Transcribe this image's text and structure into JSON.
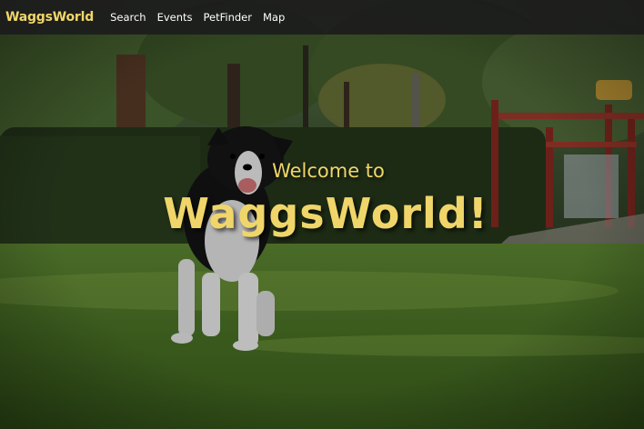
{
  "nav": {
    "brand": "WaggsWorld",
    "links": [
      "Search",
      "Events",
      "PetFinder",
      "Map"
    ]
  },
  "hero": {
    "welcome_line": "Welcome to",
    "title": "WaggsWorld!"
  },
  "colors": {
    "accent_yellow": "#f0d66a",
    "navbar_bg": "#1c1c1c",
    "link_white": "#ffffff"
  }
}
